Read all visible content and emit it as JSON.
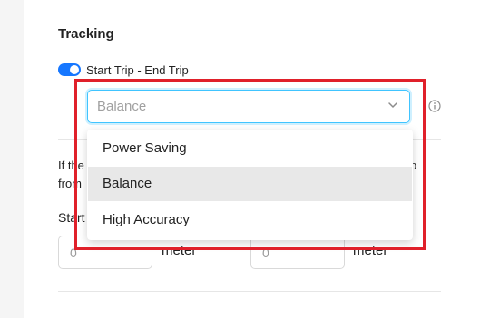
{
  "tracking": {
    "title": "Tracking",
    "toggle_label": "Start Trip - End Trip",
    "select_placeholder": "Balance",
    "description_left_1": "If the",
    "description_left_2": "from",
    "description_right_1": "p",
    "start_label": "Start",
    "input_a_value": "0",
    "input_b_value": "0",
    "unit_a": "meter",
    "unit_b": "meter"
  },
  "dropdown": {
    "options": [
      "Power Saving",
      "Balance",
      "High Accuracy"
    ],
    "selected": "Balance"
  },
  "colors": {
    "accent": "#1677ff",
    "focus_border": "#40c4ff",
    "annotation_box": "#e0202a"
  }
}
